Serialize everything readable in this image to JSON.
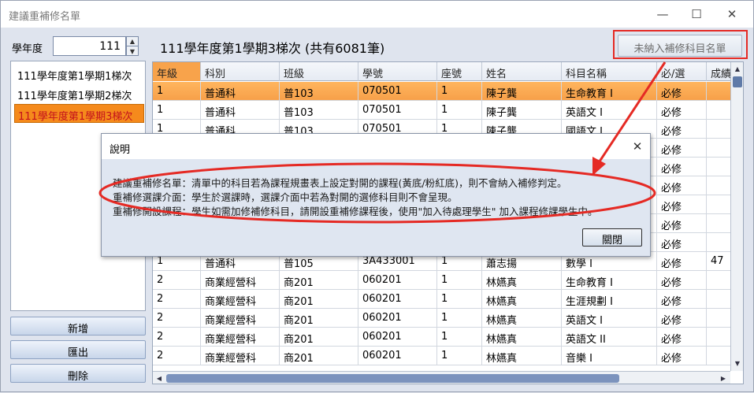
{
  "window": {
    "title": "建議重補修名單",
    "minimize_glyph": "—",
    "maximize_glyph": "☐",
    "close_glyph": "✕"
  },
  "sidebar": {
    "year_label": "學年度",
    "year_value": "111",
    "items": [
      {
        "label": "111學年度第1學期1梯次",
        "selected": false
      },
      {
        "label": "111學年度第1學期2梯次",
        "selected": false
      },
      {
        "label": "111學年度第1學期3梯次",
        "selected": true
      }
    ],
    "buttons": {
      "add": "新增",
      "export": "匯出",
      "delete": "刪除"
    }
  },
  "main": {
    "heading": "111學年度第1學期3梯次 (共有6081筆)",
    "unassigned_button": "未納入補修科目名單"
  },
  "grid": {
    "columns": [
      "年級",
      "科別",
      "班級",
      "學號",
      "座號",
      "姓名",
      "科目名稱",
      "必/選",
      "成績"
    ],
    "rows": [
      [
        "1",
        "普通科",
        "普103",
        "070501",
        "1",
        "陳子龔",
        "生命教育 I",
        "必修",
        ""
      ],
      [
        "1",
        "普通科",
        "普103",
        "070501",
        "1",
        "陳子龔",
        "英語文 I",
        "必修",
        ""
      ],
      [
        "1",
        "普通科",
        "普103",
        "070501",
        "1",
        "陳子龔",
        "國語文 I",
        "必修",
        ""
      ],
      [
        "",
        "",
        "",
        "",
        "",
        "",
        "",
        "必修",
        ""
      ],
      [
        "",
        "",
        "",
        "",
        "",
        "",
        "",
        "必修",
        ""
      ],
      [
        "",
        "",
        "",
        "",
        "",
        "",
        "",
        "必修",
        ""
      ],
      [
        "",
        "",
        "",
        "",
        "",
        "",
        "",
        "必修",
        ""
      ],
      [
        "",
        "",
        "",
        "",
        "",
        "",
        "",
        "必修",
        ""
      ],
      [
        "",
        "",
        "",
        "",
        "",
        "",
        "",
        "必修",
        ""
      ],
      [
        "1",
        "普通科",
        "普105",
        "3A433001",
        "1",
        "蕭志揚",
        "數學 I",
        "必修",
        "47"
      ],
      [
        "2",
        "商業經營科",
        "商201",
        "060201",
        "1",
        "林嬿真",
        "生命教育 I",
        "必修",
        ""
      ],
      [
        "2",
        "商業經營科",
        "商201",
        "060201",
        "1",
        "林嬿真",
        "生涯規劃 I",
        "必修",
        ""
      ],
      [
        "2",
        "商業經營科",
        "商201",
        "060201",
        "1",
        "林嬿真",
        "英語文 I",
        "必修",
        ""
      ],
      [
        "2",
        "商業經營科",
        "商201",
        "060201",
        "1",
        "林嬿真",
        "英語文 II",
        "必修",
        ""
      ],
      [
        "2",
        "商業經營科",
        "商201",
        "060201",
        "1",
        "林嬿真",
        "音樂 I",
        "必修",
        ""
      ]
    ]
  },
  "dialog": {
    "title": "說明",
    "lines": [
      "建議重補修名單：清單中的科目若為課程規畫表上設定對開的課程(黃底/粉紅底)，則不會納入補修判定。",
      "重補修選課介面：學生於選課時，選課介面中若為對開的選修科目則不會呈現。",
      "重補修開設課程：學生如需加修補修科目，請開設重補修課程後，使用\"加入待處理學生\" 加入課程修課學生中。"
    ],
    "close_label": "關閉",
    "close_glyph": "✕"
  },
  "annotation": {
    "color": "#e52a24"
  }
}
